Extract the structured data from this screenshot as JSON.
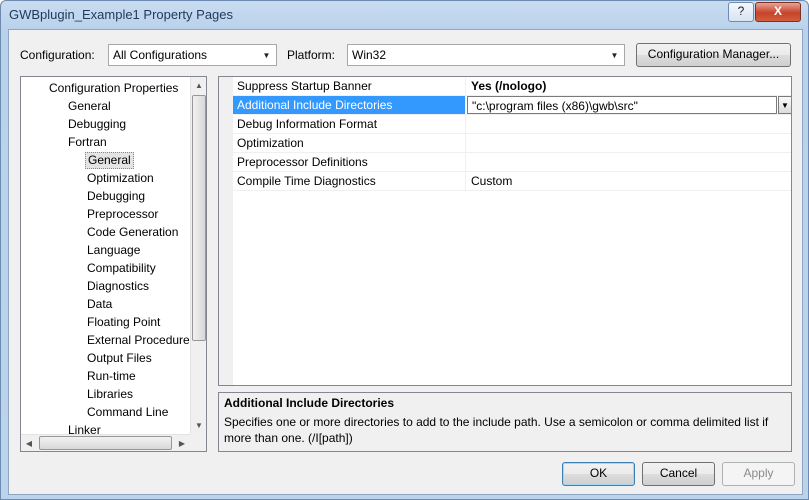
{
  "window": {
    "title": "GWBplugin_Example1 Property Pages",
    "help_label": "?",
    "close_label": "X"
  },
  "toolbar": {
    "configuration_label": "Configuration:",
    "configuration_value": "All Configurations",
    "platform_label": "Platform:",
    "platform_value": "Win32",
    "config_manager_label": "Configuration Manager..."
  },
  "tree": {
    "items": [
      {
        "label": "Configuration Properties",
        "level": 0
      },
      {
        "label": "General",
        "level": 1
      },
      {
        "label": "Debugging",
        "level": 1
      },
      {
        "label": "Fortran",
        "level": 1
      },
      {
        "label": "General",
        "level": 2,
        "selected": true
      },
      {
        "label": "Optimization",
        "level": 2
      },
      {
        "label": "Debugging",
        "level": 2
      },
      {
        "label": "Preprocessor",
        "level": 2
      },
      {
        "label": "Code Generation",
        "level": 2
      },
      {
        "label": "Language",
        "level": 2
      },
      {
        "label": "Compatibility",
        "level": 2
      },
      {
        "label": "Diagnostics",
        "level": 2
      },
      {
        "label": "Data",
        "level": 2
      },
      {
        "label": "Floating Point",
        "level": 2
      },
      {
        "label": "External Procedures",
        "level": 2
      },
      {
        "label": "Output Files",
        "level": 2
      },
      {
        "label": "Run-time",
        "level": 2
      },
      {
        "label": "Libraries",
        "level": 2
      },
      {
        "label": "Command Line",
        "level": 2
      },
      {
        "label": "Linker",
        "level": 1
      }
    ]
  },
  "properties": [
    {
      "name": "Suppress Startup Banner",
      "value": "Yes (/nologo)"
    },
    {
      "name": "Additional Include Directories",
      "value": "\"c:\\program files (x86)\\gwb\\src\""
    },
    {
      "name": "Debug Information Format",
      "value": ""
    },
    {
      "name": "Optimization",
      "value": ""
    },
    {
      "name": "Preprocessor Definitions",
      "value": ""
    },
    {
      "name": "Compile Time Diagnostics",
      "value": "Custom"
    }
  ],
  "description": {
    "title": "Additional Include Directories",
    "text": "Specifies one or more directories to add to the include path. Use a semicolon or comma delimited list if more than one. (/I[path])"
  },
  "buttons": {
    "ok": "OK",
    "cancel": "Cancel",
    "apply": "Apply"
  }
}
